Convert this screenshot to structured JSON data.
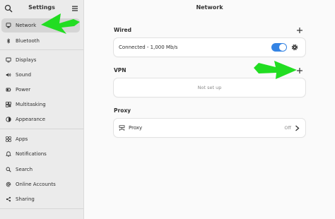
{
  "sidebar": {
    "title": "Settings",
    "items": [
      {
        "label": "Network",
        "icon": "network-icon",
        "active": true
      },
      {
        "label": "Bluetooth",
        "icon": "bluetooth-icon"
      },
      {
        "label": "Displays",
        "icon": "display-icon"
      },
      {
        "label": "Sound",
        "icon": "sound-icon"
      },
      {
        "label": "Power",
        "icon": "power-icon"
      },
      {
        "label": "Multitasking",
        "icon": "multitasking-icon"
      },
      {
        "label": "Appearance",
        "icon": "appearance-icon"
      },
      {
        "label": "Apps",
        "icon": "apps-icon"
      },
      {
        "label": "Notifications",
        "icon": "bell-icon"
      },
      {
        "label": "Search",
        "icon": "search-icon"
      },
      {
        "label": "Online Accounts",
        "icon": "at-icon"
      },
      {
        "label": "Sharing",
        "icon": "share-icon"
      }
    ]
  },
  "main": {
    "title": "Network",
    "wired": {
      "title": "Wired",
      "connection_label": "Connected - 1,000 Mb/s",
      "toggle_on": true
    },
    "vpn": {
      "title": "VPN",
      "empty_label": "Not set up"
    },
    "proxy": {
      "title": "Proxy",
      "label": "Proxy",
      "value": "Off"
    }
  },
  "colors": {
    "accent": "#3584e4",
    "annotation_arrow": "#22dd22"
  }
}
